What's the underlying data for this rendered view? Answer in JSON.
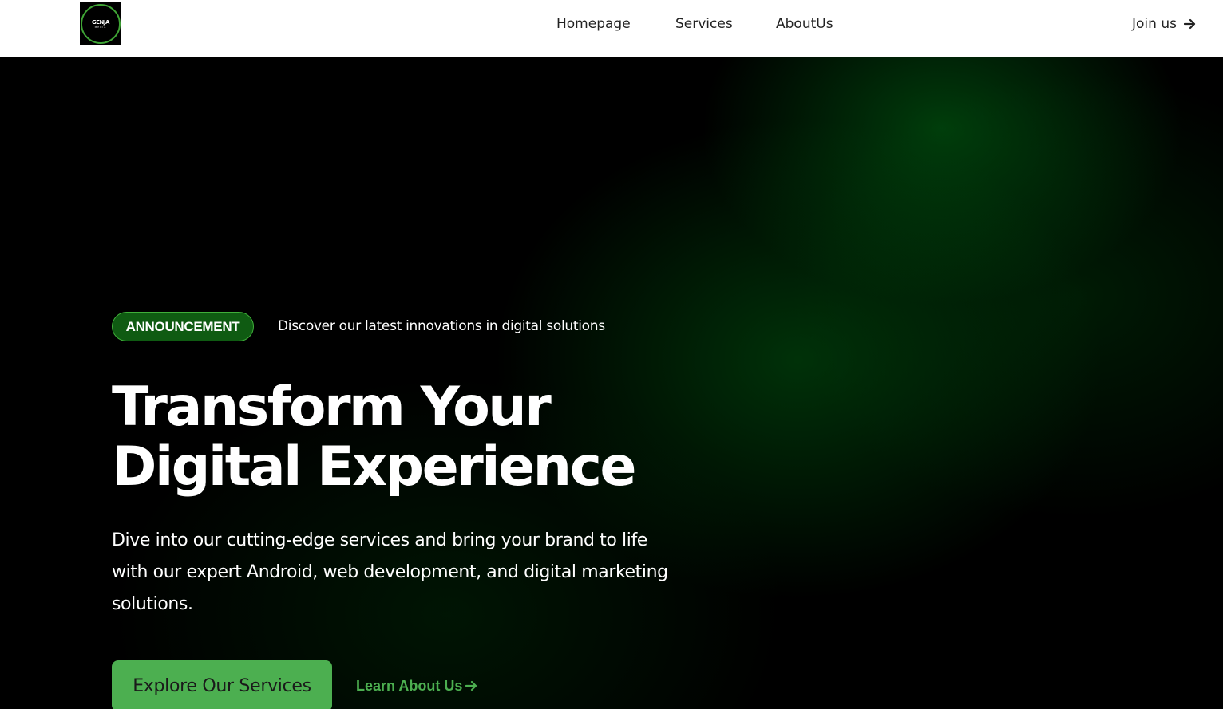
{
  "brand": {
    "logo_text": "GENJA",
    "logo_sub": "MEDIA",
    "accent": "#4caf50",
    "badge_bg": "#0f5b12"
  },
  "nav": {
    "links": [
      {
        "label": "Homepage"
      },
      {
        "label": "Services"
      },
      {
        "label": "AboutUs"
      }
    ],
    "join_label": "Join us",
    "join_icon": "arrow-right-icon"
  },
  "hero": {
    "badge": "ANNOUNCEMENT",
    "announcement": "Discover our latest innovations in digital solutions",
    "headline_line1": "Transform Your",
    "headline_line2": "Digital Experience",
    "description": "Dive into our cutting-edge services and bring your brand to life with our expert Android, web development, and digital marketing solutions.",
    "primary_cta": "Explore Our Services",
    "secondary_cta": "Learn About Us",
    "secondary_icon": "arrow-right-icon"
  }
}
